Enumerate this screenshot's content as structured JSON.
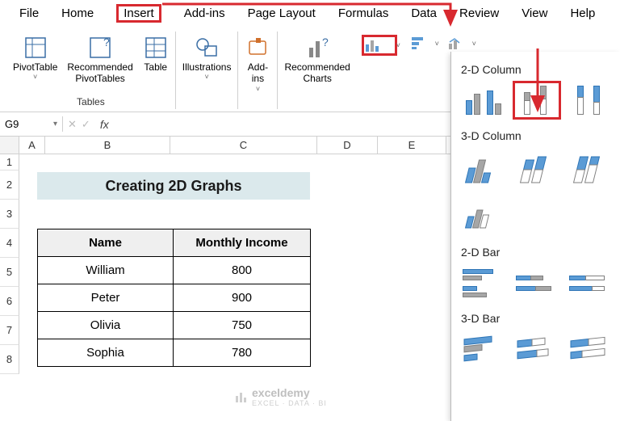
{
  "menu": {
    "file": "File",
    "home": "Home",
    "insert": "Insert",
    "addins": "Add-ins",
    "pagelayout": "Page Layout",
    "formulas": "Formulas",
    "data": "Data",
    "review": "Review",
    "view": "View",
    "help": "Help"
  },
  "ribbon": {
    "pivottable": "PivotTable",
    "recpivot": "Recommended\nPivotTables",
    "table": "Table",
    "tables_group": "Tables",
    "illustrations": "Illustrations",
    "addins": "Add-\nins",
    "reccharts": "Recommended\nCharts"
  },
  "namebox": "G9",
  "colheaders": [
    "A",
    "B",
    "C",
    "D",
    "E"
  ],
  "rowheaders": [
    "1",
    "2",
    "3",
    "4",
    "5",
    "6",
    "7",
    "8"
  ],
  "title": "Creating 2D Graphs",
  "table": {
    "headers": [
      "Name",
      "Monthly Income"
    ],
    "rows": [
      [
        "William",
        "800"
      ],
      [
        "Peter",
        "900"
      ],
      [
        "Olivia",
        "750"
      ],
      [
        "Sophia",
        "780"
      ]
    ]
  },
  "chartpanel": {
    "h1": "2-D Column",
    "h2": "3-D Column",
    "h3": "2-D Bar",
    "h4": "3-D Bar"
  },
  "watermark": {
    "brand": "exceldemy",
    "sub": "EXCEL · DATA · BI"
  },
  "chart_data": {
    "type": "bar",
    "categories": [
      "William",
      "Peter",
      "Olivia",
      "Sophia"
    ],
    "values": [
      800,
      900,
      750,
      780
    ],
    "title": "Creating 2D Graphs",
    "xlabel": "Name",
    "ylabel": "Monthly Income",
    "ylim": [
      0,
      1000
    ]
  }
}
